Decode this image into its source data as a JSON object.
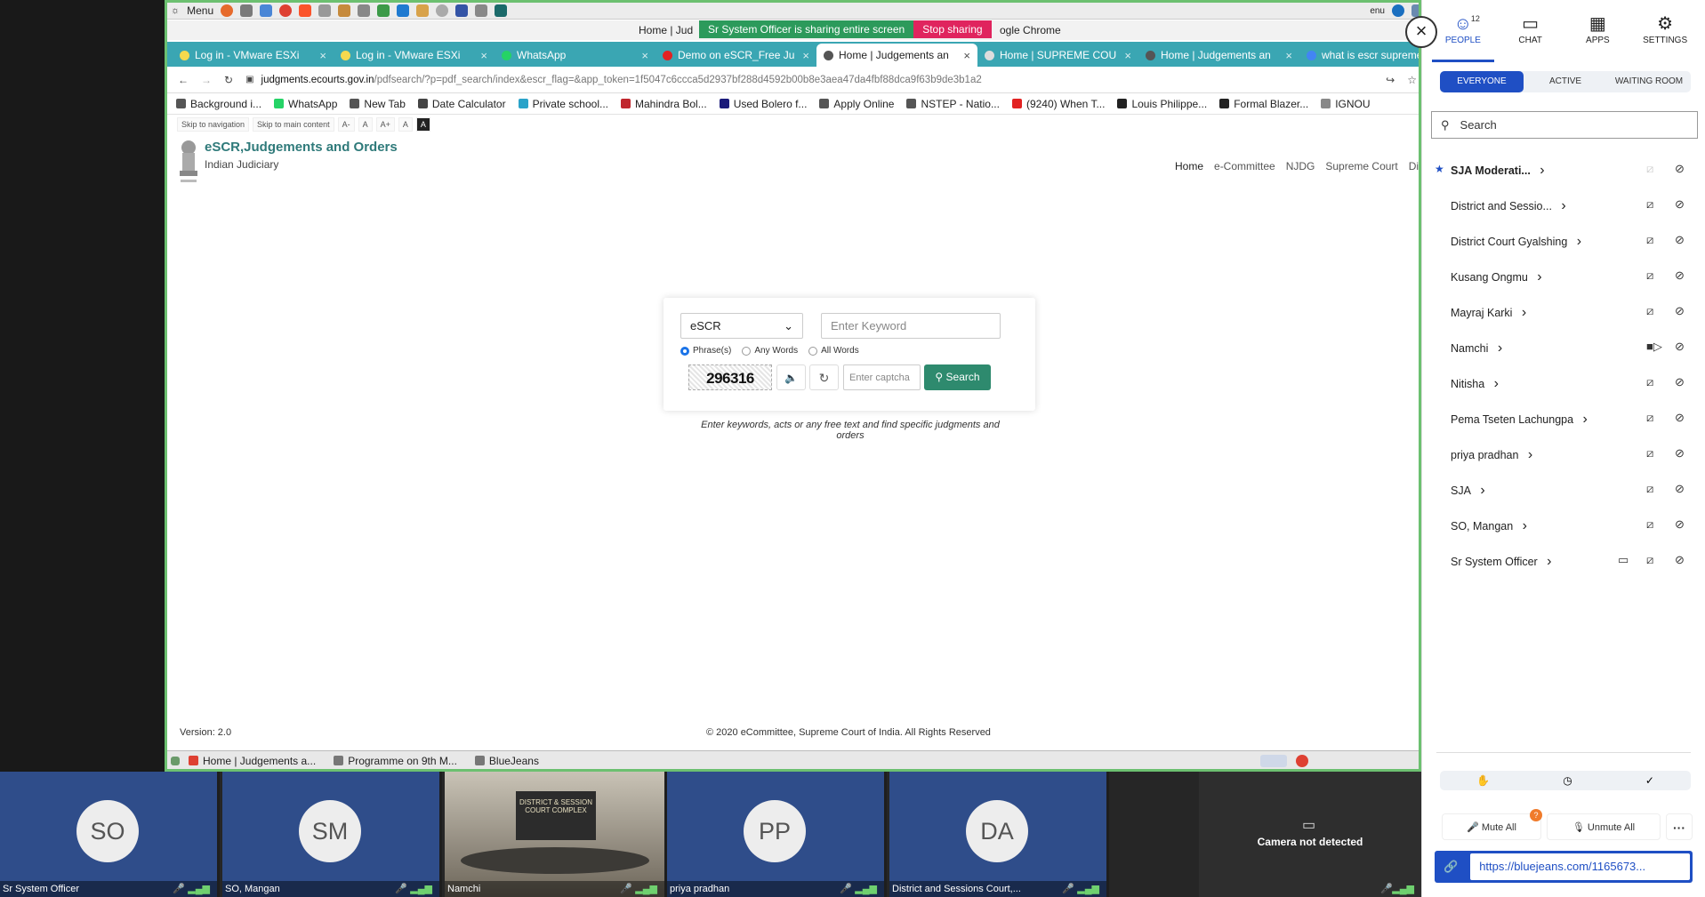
{
  "taskbar": {
    "menu_label": "Menu",
    "tray_lang": "enu"
  },
  "window": {
    "title": "Home | Judgements and Orders - Google Chrome",
    "title_left": "Home | Jud",
    "title_right": "ogle Chrome"
  },
  "share_banner": {
    "message": "Sr System Officer is sharing entire screen",
    "stop_label": "Stop sharing"
  },
  "browser": {
    "tabs": [
      {
        "label": "Log in - VMware ESXi",
        "active": false,
        "color": "#f5d94e"
      },
      {
        "label": "Log in - VMware ESXi",
        "active": false,
        "color": "#f5d94e"
      },
      {
        "label": "WhatsApp",
        "active": false,
        "color": "#25d366"
      },
      {
        "label": "Demo on eSCR_Free Ju",
        "active": false,
        "color": "#e22222"
      },
      {
        "label": "Home | Judgements an",
        "active": true,
        "color": "#555555"
      },
      {
        "label": "Home | SUPREME COU",
        "active": false,
        "color": "#dddddd"
      },
      {
        "label": "Home | Judgements an",
        "active": false,
        "color": "#555555"
      },
      {
        "label": "what is escr supreme",
        "active": false,
        "color": "#4285f4"
      }
    ],
    "url_host": "judgments.ecourts.gov.in",
    "url_path": "/pdfsearch/?p=pdf_search/index&escr_flag=&app_token=1f5047c6ccca5d2937bf288d4592b00b8e3aea47da4fbf88dca9f63b9de3b1a2",
    "bookmarks": [
      {
        "label": "Background i...",
        "color": "#555555"
      },
      {
        "label": "WhatsApp",
        "color": "#25d366"
      },
      {
        "label": "New Tab",
        "color": "#555555"
      },
      {
        "label": "Date Calculator",
        "color": "#444444"
      },
      {
        "label": "Private school...",
        "color": "#2aa3c9"
      },
      {
        "label": "Mahindra Bol...",
        "color": "#c0262d"
      },
      {
        "label": "Used Bolero f...",
        "color": "#1a1a7a"
      },
      {
        "label": "Apply Online",
        "color": "#555555"
      },
      {
        "label": "NSTEP - Natio...",
        "color": "#555555"
      },
      {
        "label": "(9240) When T...",
        "color": "#e22222"
      },
      {
        "label": "Louis Philippe...",
        "color": "#222222"
      },
      {
        "label": "Formal Blazer...",
        "color": "#222222"
      },
      {
        "label": "IGNOU",
        "color": "#888888"
      }
    ]
  },
  "site": {
    "accessibility": [
      "Skip to navigation",
      "Skip to main content",
      "A-",
      "A",
      "A+",
      "A",
      "A"
    ],
    "title": "eSCR,Judgements and Orders",
    "subtitle": "Indian Judiciary",
    "nav": [
      "Home",
      "e-Committee",
      "NJDG",
      "Supreme Court",
      "Distri"
    ],
    "search": {
      "select_value": "eSCR",
      "keyword_placeholder": "Enter Keyword",
      "radios": [
        {
          "label": "Phrase(s)",
          "checked": true
        },
        {
          "label": "Any Words",
          "checked": false
        },
        {
          "label": "All Words",
          "checked": false
        }
      ],
      "captcha_text": "296316",
      "captcha_placeholder": "Enter captcha",
      "search_label": "Search"
    },
    "hint": "Enter keywords, acts or any free text and find specific judgments and orders",
    "version": "Version: 2.0",
    "copyright": "© 2020 eCommittee, Supreme Court of India. All Rights Reserved"
  },
  "os_footbar": {
    "items": [
      "Home | Judgements a...",
      "Programme on 9th M...",
      "BlueJeans"
    ]
  },
  "videos": {
    "tiles": [
      {
        "initials": "SO",
        "name": "Sr System Officer"
      },
      {
        "initials": "SM",
        "name": "SO, Mangan"
      },
      {
        "initials": "",
        "name": "Namchi"
      },
      {
        "initials": "PP",
        "name": "priya pradhan"
      },
      {
        "initials": "DA",
        "name": "District and Sessions Court,..."
      }
    ],
    "camera_message": "Camera not detected"
  },
  "panel": {
    "tabs": [
      {
        "label": "PEOPLE",
        "icon": "people-icon",
        "active": true
      },
      {
        "label": "CHAT",
        "icon": "chat-icon",
        "active": false
      },
      {
        "label": "APPS",
        "icon": "apps-icon",
        "active": false
      },
      {
        "label": "SETTINGS",
        "icon": "gear-icon",
        "active": false
      }
    ],
    "people_count": "12",
    "segments": [
      "EVERYONE",
      "ACTIVE",
      "WAITING ROOM"
    ],
    "search_placeholder": "Search",
    "participants": [
      {
        "name": "SJA Moderati...",
        "bold": true,
        "star": true,
        "video": "off-dim",
        "screen": false
      },
      {
        "name": "District and Sessio...",
        "bold": false,
        "star": false,
        "video": "off",
        "screen": false
      },
      {
        "name": "District Court Gyalshing",
        "bold": false,
        "star": false,
        "video": "off",
        "screen": false
      },
      {
        "name": "Kusang Ongmu",
        "bold": false,
        "star": false,
        "video": "off",
        "screen": false
      },
      {
        "name": "Mayraj Karki",
        "bold": false,
        "star": false,
        "video": "off",
        "screen": false
      },
      {
        "name": "Namchi",
        "bold": false,
        "star": false,
        "video": "on",
        "screen": false
      },
      {
        "name": "Nitisha",
        "bold": false,
        "star": false,
        "video": "off",
        "screen": false
      },
      {
        "name": "Pema Tseten Lachungpa",
        "bold": false,
        "star": false,
        "video": "off",
        "screen": false
      },
      {
        "name": "priya pradhan",
        "bold": false,
        "star": false,
        "video": "off",
        "screen": false
      },
      {
        "name": "SJA",
        "bold": false,
        "star": false,
        "video": "off",
        "screen": false
      },
      {
        "name": "SO, Mangan",
        "bold": false,
        "star": false,
        "video": "off",
        "screen": false
      },
      {
        "name": "Sr System Officer",
        "bold": false,
        "star": false,
        "video": "off",
        "screen": true
      }
    ],
    "mute_all": "Mute All",
    "unmute_all": "Unmute All",
    "mute_badge": "?",
    "meeting_link": "https://bluejeans.com/1165673..."
  }
}
